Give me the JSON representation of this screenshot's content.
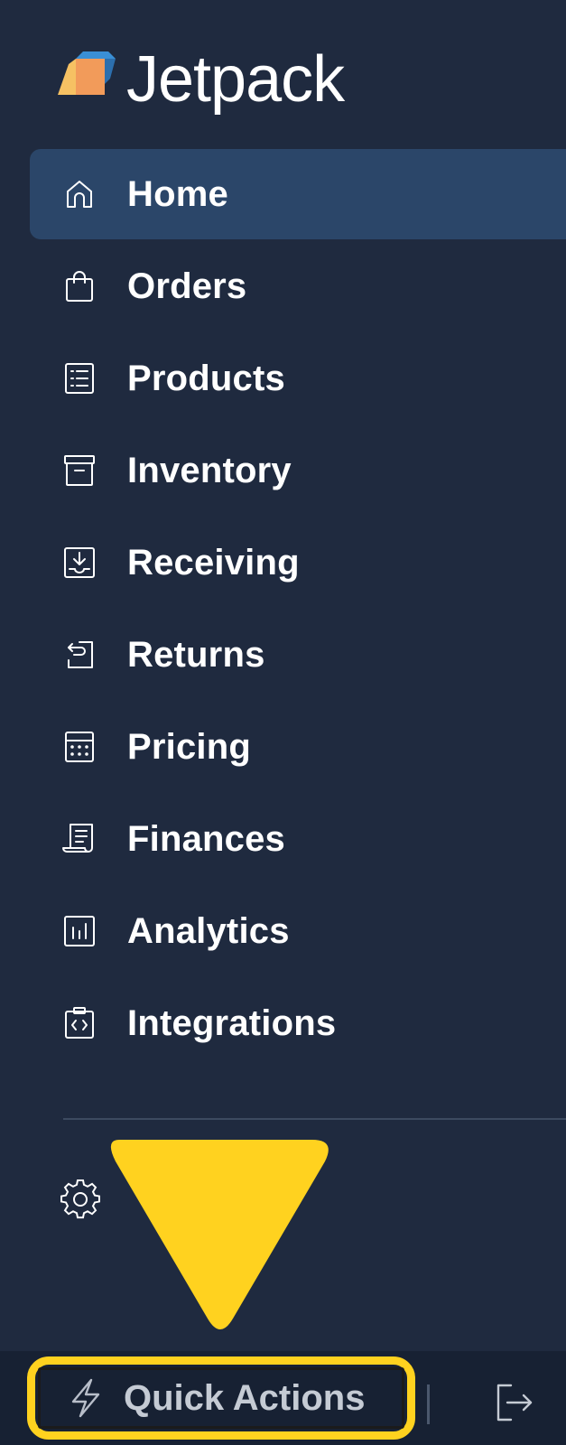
{
  "app": {
    "name": "Jetpack"
  },
  "nav": {
    "items": [
      {
        "label": "Home",
        "icon": "home-icon",
        "active": true
      },
      {
        "label": "Orders",
        "icon": "shopping-bag-icon",
        "active": false
      },
      {
        "label": "Products",
        "icon": "list-icon",
        "active": false
      },
      {
        "label": "Inventory",
        "icon": "archive-box-icon",
        "active": false
      },
      {
        "label": "Receiving",
        "icon": "inbox-download-icon",
        "active": false
      },
      {
        "label": "Returns",
        "icon": "return-arrow-icon",
        "active": false
      },
      {
        "label": "Pricing",
        "icon": "calculator-icon",
        "active": false
      },
      {
        "label": "Finances",
        "icon": "receipt-icon",
        "active": false
      },
      {
        "label": "Analytics",
        "icon": "bar-chart-icon",
        "active": false
      },
      {
        "label": "Integrations",
        "icon": "code-clipboard-icon",
        "active": false
      }
    ]
  },
  "settings": {
    "icon": "gear-icon"
  },
  "footer": {
    "quick_actions_label": "Quick Actions",
    "quick_actions_icon": "lightning-icon",
    "logout_icon": "logout-icon"
  },
  "colors": {
    "sidebar_bg": "#1f2a3f",
    "active_bg": "#2b4669",
    "footer_bg": "#172133",
    "highlight": "#ffd21f",
    "logo_orange": "#f29b5a",
    "logo_blue": "#3a8fd6"
  }
}
